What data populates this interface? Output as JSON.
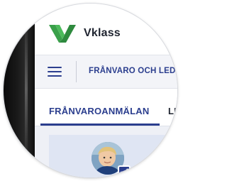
{
  "app": {
    "brand_name": "Vklass",
    "brand_color": "#2b3e8e",
    "logo_color": "#3aa04a"
  },
  "navbar": {
    "menu_icon": "hamburger-menu-icon",
    "title": "FRÅNVARO OCH LEDIG"
  },
  "tabs": {
    "active_label": "FRÅNVAROANMÄLAN",
    "next_label": "LED"
  },
  "profile": {
    "avatar": "child-portrait",
    "selected_icon": "checkbox-checked-icon"
  }
}
